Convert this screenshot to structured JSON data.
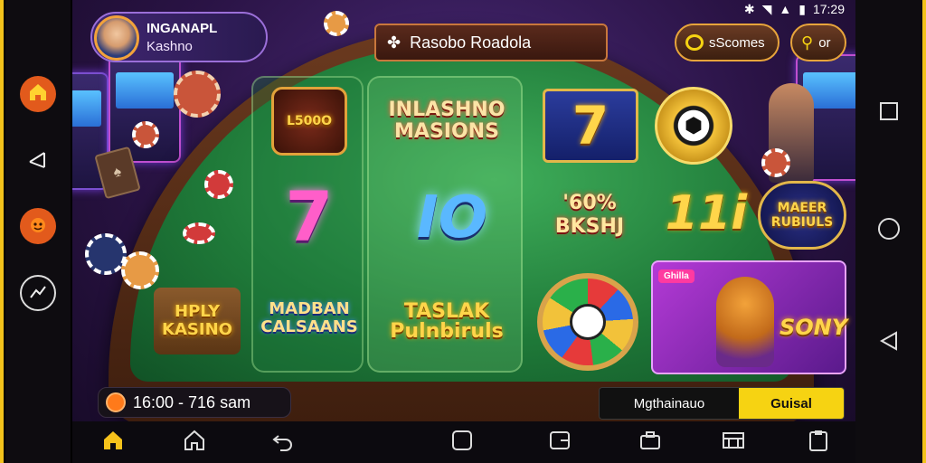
{
  "status_bar": {
    "time": "17:29"
  },
  "profile": {
    "name": "INGANAPL",
    "subtitle": "Kashno"
  },
  "title_banner": {
    "label": "Rasobo Roadola",
    "icon": "clover-icon"
  },
  "top_right": {
    "scores_label": "sScomes",
    "scores_icon": "chat-bubble-icon",
    "menu_label": "or",
    "menu_icon": "key-icon"
  },
  "games": [
    {
      "label": "L500O"
    },
    {
      "label": "INLASHNO MASIONS"
    },
    {
      "label": "7"
    },
    {
      "label": "7"
    },
    {
      "label": "IO"
    },
    {
      "label": "'60% BKSHJ"
    },
    {
      "label": "11i"
    },
    {
      "label": "MAEER RUBIULS"
    },
    {
      "label": "HPLY KASINO"
    },
    {
      "label": "MADBAN CALSAANS"
    },
    {
      "label": "TASLAK Pulnbiruls"
    },
    {
      "label": "SONY",
      "tag": "Ghilla"
    }
  ],
  "balance": {
    "text": "16:00 - 716 sam",
    "icon": "pumpkin-icon"
  },
  "action": {
    "left_label": "Mgthainauo",
    "right_label": "Guisal"
  },
  "left_nav": [
    {
      "icon": "home-icon"
    },
    {
      "icon": "share-icon"
    },
    {
      "icon": "pumpkin-icon"
    },
    {
      "icon": "chart-icon"
    }
  ],
  "right_nav": [
    {
      "icon": "square-icon"
    },
    {
      "icon": "circle-icon"
    },
    {
      "icon": "back-triangle-icon"
    }
  ],
  "bottom_nav": [
    {
      "icon": "home-icon",
      "active": true
    },
    {
      "icon": "house-outline-icon"
    },
    {
      "icon": "undo-icon"
    },
    {
      "icon": "square-icon"
    },
    {
      "icon": "tab-icon"
    },
    {
      "icon": "briefcase-icon"
    },
    {
      "icon": "store-icon"
    },
    {
      "icon": "clipboard-icon"
    }
  ],
  "colors": {
    "frame": "#f2c21b",
    "felt": "#1f7a39",
    "accent_yellow": "#f6d312",
    "rim": "#6b3a1f"
  }
}
